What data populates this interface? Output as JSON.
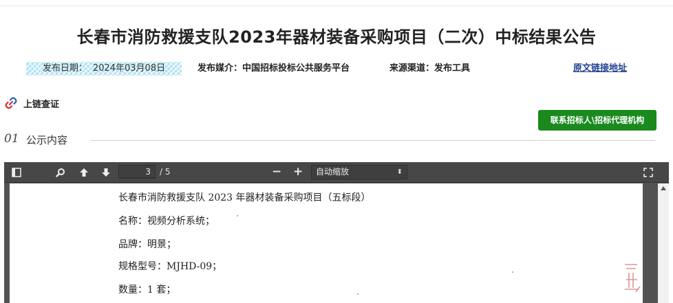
{
  "header": {
    "title": "长春市消防救援支队2023年器材装备采购项目（二次）中标结果公告",
    "publish_date_label": "发布日期：",
    "publish_date_value": "2024年03月08日",
    "media": "发布媒介：中国招标投标公共服务平台",
    "channel": "来源渠道：发布工具",
    "original_link": "原文链接地址"
  },
  "chain_verify": {
    "label": "上链查证",
    "icon": "link-icon"
  },
  "contact_button": "联系招标人\\招标代理机构",
  "section": {
    "number": "01",
    "title": "公示内容"
  },
  "viewer": {
    "page_current": "3",
    "page_total": "/ 5",
    "zoom_out": "−",
    "zoom_in": "+",
    "zoom_mode": "自动缩放",
    "zoom_caret": "⬍",
    "stamp_text": "ī",
    "document_lines": [
      "长春市消防救援支队 2023 年器材装备采购项目（五标段）",
      "名称：视频分析系统；",
      "品牌：明景；",
      "规格型号：MJHD-09；",
      "数量：1 套；"
    ]
  },
  "colors": {
    "accent_green": "#1a8a1e",
    "link_blue": "#1f3f8f",
    "viewer_bg": "#525252",
    "toolbar_bg": "#474747",
    "date_bg": "#a9dff2"
  }
}
